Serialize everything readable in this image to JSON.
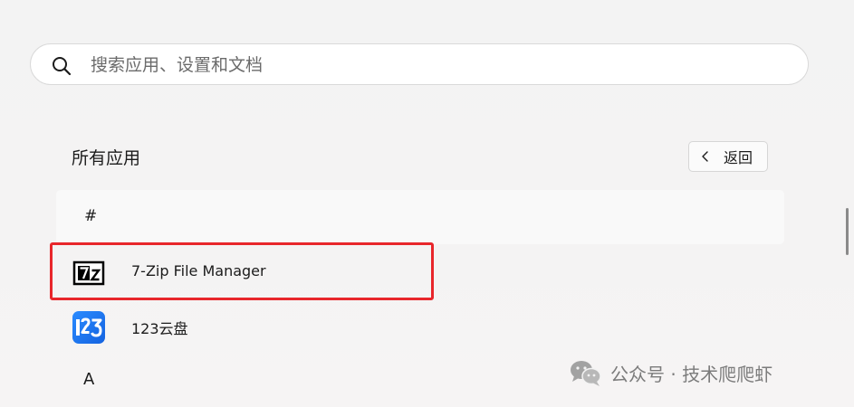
{
  "search": {
    "placeholder": "搜索应用、设置和文档",
    "icon": "search-icon"
  },
  "section": {
    "title": "所有应用",
    "back_button": {
      "label": "返回",
      "icon": "chevron-left-icon"
    }
  },
  "groups": [
    {
      "header": "#",
      "apps": [
        {
          "name": "7-Zip File Manager",
          "icon": "7zip-icon",
          "highlighted": true
        },
        {
          "name": "123云盘",
          "icon": "123pan-icon",
          "highlighted": false
        }
      ]
    },
    {
      "header": "A",
      "apps": []
    }
  ],
  "watermark": {
    "text": "公众号 · 技术爬爬虾",
    "icon": "wechat-icon"
  },
  "colors": {
    "highlight_border": "#e8262b",
    "pan_icon_blue": "#1d7bff"
  }
}
